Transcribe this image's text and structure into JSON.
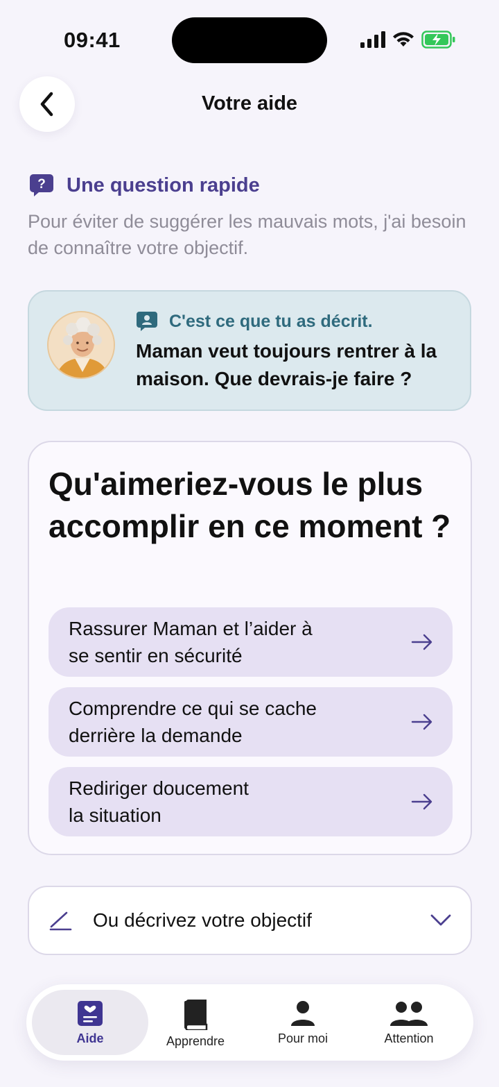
{
  "status": {
    "time": "09:41"
  },
  "header": {
    "title": "Votre aide"
  },
  "quick_question": {
    "title": "Une question rapide",
    "description": "Pour éviter de suggérer les mauvais mots, j'ai besoin de connaître votre objectif."
  },
  "described": {
    "label": "C'est ce que tu as décrit.",
    "text": "Maman veut toujours rentrer à la maison. Que devrais-je faire ?"
  },
  "question": {
    "title": "Qu'aimeriez-vous le plus accomplir en ce moment ?",
    "options": [
      {
        "line1": "Rassurer Maman et l’aider à",
        "line2": "se sentir en sécurité"
      },
      {
        "line1": "Comprendre ce qui se cache",
        "line2": "derrière la demande"
      },
      {
        "line1": "Rediriger doucement",
        "line2": "la situation"
      }
    ]
  },
  "objective": {
    "label": "Ou décrivez votre objectif"
  },
  "tabs": [
    {
      "label": "Aide",
      "icon": "help-card-icon",
      "active": true
    },
    {
      "label": "Apprendre",
      "icon": "book-icon",
      "active": false
    },
    {
      "label": "Pour moi",
      "icon": "person-icon",
      "active": false
    },
    {
      "label": "Attention",
      "icon": "group-icon",
      "active": false
    }
  ],
  "colors": {
    "accent": "#4b3f8f",
    "option_bg": "#e6e0f3",
    "card_blue": "#dce9ee"
  }
}
